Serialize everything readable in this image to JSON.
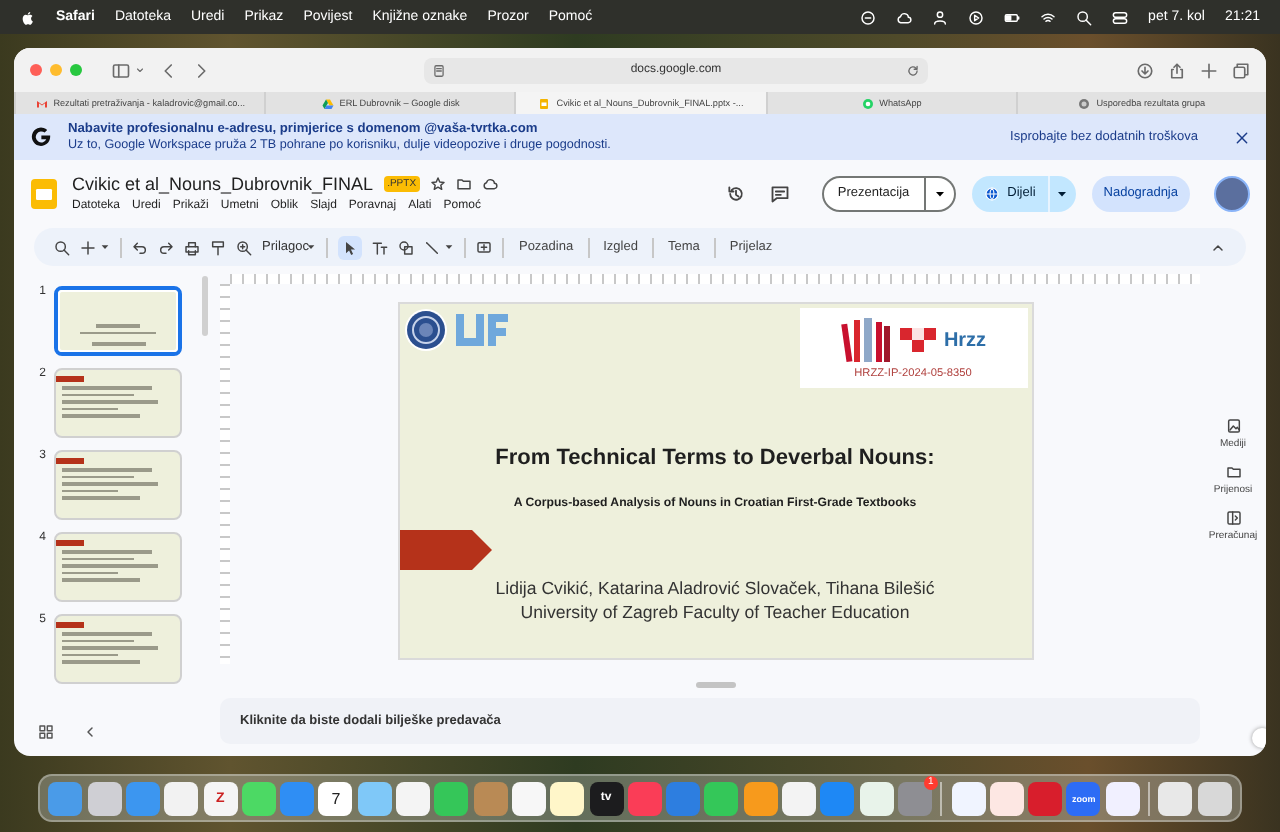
{
  "menu_bar": {
    "app": "Safari",
    "items": [
      "Datoteka",
      "Uredi",
      "Prikaz",
      "Povijest",
      "Knjižne oznake",
      "Prozor",
      "Pomoć"
    ],
    "date": "pet 7. kol",
    "time": "21:21"
  },
  "browser": {
    "address": "docs.google.com",
    "tabs": [
      {
        "label": "Rezultati pretraživanja - kaladrovic@gmail.co...",
        "kind": "gmail",
        "selected": false
      },
      {
        "label": "ERL Dubrovnik – Google disk",
        "kind": "drive",
        "selected": false
      },
      {
        "label": "Cvikic et al_Nouns_Dubrovnik_FINAL.pptx -...",
        "kind": "slides",
        "selected": true
      },
      {
        "label": "WhatsApp",
        "kind": "whatsapp",
        "selected": false
      },
      {
        "label": "Usporedba rezultata grupa",
        "kind": "generic",
        "selected": false
      }
    ]
  },
  "banner": {
    "title": "Nabavite profesionalnu e-adresu, primjerice s domenom @vaša-tvrtka.com",
    "text": "Uz to, Google Workspace pruža 2 TB pohrane po korisniku, dulje videopozive i druge pogodnosti.",
    "link": "Isprobajte bez dodatnih troškova"
  },
  "document": {
    "title": "Cvikic et al_Nouns_Dubrovnik_FINAL",
    "badge": ".PPTX",
    "menus": [
      "Datoteka",
      "Uredi",
      "Prikaži",
      "Umetni",
      "Oblik",
      "Slajd",
      "Poravnaj",
      "Alati",
      "Pomoć"
    ],
    "present_button": "Prezentacija",
    "share_button": "Dijeli",
    "upgrade_button": "Nadogradnja"
  },
  "toolbar": {
    "zoom": "Prilagoc",
    "pointer_selected": true,
    "buttons": [
      "Pozadina",
      "Izgled",
      "Tema",
      "Prijelaz"
    ]
  },
  "slides": [
    {
      "number": "1",
      "selected": true
    },
    {
      "number": "2",
      "selected": false
    },
    {
      "number": "3",
      "selected": false
    },
    {
      "number": "4",
      "selected": false
    },
    {
      "number": "5",
      "selected": false
    }
  ],
  "slide": {
    "logo_text": "Hrzz",
    "project_code": "HRZZ-IP-2024-05-8350",
    "title": "From Technical Terms to Deverbal Nouns:",
    "subtitle": "A Corpus-based Analysis of Nouns in Croatian First-Grade Textbooks",
    "authors": "Lidija Cvikić,  Katarina Aladrović Slovaček,  Tihana Bilešić",
    "institution": "University of Zagreb Faculty of Teacher Education"
  },
  "notes": "Kliknite da biste dodali bilješke predavača",
  "side_panel": [
    {
      "label": "Mediji",
      "kind": "media"
    },
    {
      "label": "Prijenosi",
      "kind": "folder"
    },
    {
      "label": "Preračunaj",
      "kind": "convert"
    }
  ],
  "dock": [
    {
      "kind": "app",
      "color": "#4a9be8"
    },
    {
      "kind": "app",
      "color": "#cfcfd4"
    },
    {
      "kind": "app",
      "color": "#3c96f0"
    },
    {
      "kind": "app",
      "color": "#f2f2f2"
    },
    {
      "kind": "app",
      "color": "#f5f5f5",
      "glyph": "Z"
    },
    {
      "kind": "app",
      "color": "#4cd964"
    },
    {
      "kind": "app",
      "color": "#2f8ef4"
    },
    {
      "kind": "app",
      "color": "#ffffff",
      "glyph": "7"
    },
    {
      "kind": "app",
      "color": "#7fc8f8"
    },
    {
      "kind": "app",
      "color": "#f4f4f4"
    },
    {
      "kind": "app",
      "color": "#35c659"
    },
    {
      "kind": "app",
      "color": "#b98a55"
    },
    {
      "kind": "app",
      "color": "#f7f7f7"
    },
    {
      "kind": "app",
      "color": "#fff6c9"
    },
    {
      "kind": "app",
      "color": "#1c1c1e",
      "glyph": "tv"
    },
    {
      "kind": "app",
      "color": "#fa3d57"
    },
    {
      "kind": "app",
      "color": "#2d7ee0"
    },
    {
      "kind": "app",
      "color": "#34c759"
    },
    {
      "kind": "app",
      "color": "#f79a1c"
    },
    {
      "kind": "app",
      "color": "#f3f3f3"
    },
    {
      "kind": "app",
      "color": "#1e88f5"
    },
    {
      "kind": "app",
      "color": "#e8f3ea"
    },
    {
      "kind": "app",
      "color": "#8e8e93",
      "badge": "1"
    },
    {
      "kind": "separator"
    },
    {
      "kind": "app",
      "color": "#f0f4ff"
    },
    {
      "kind": "app",
      "color": "#fde7e3"
    },
    {
      "kind": "app",
      "color": "#d81e2c"
    },
    {
      "kind": "app",
      "color": "#2d6cf5",
      "glyph": "zoom"
    },
    {
      "kind": "app",
      "color": "#f1f0ff"
    },
    {
      "kind": "separator"
    },
    {
      "kind": "app",
      "color": "#e8e8e8"
    },
    {
      "kind": "app",
      "color": "#d8d8d8"
    }
  ]
}
